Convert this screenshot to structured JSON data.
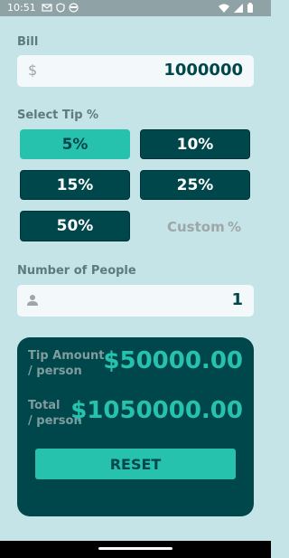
{
  "status": {
    "time": "10:51"
  },
  "bill": {
    "label": "Bill",
    "currency_symbol": "$",
    "value": "1000000"
  },
  "tip": {
    "label": "Select Tip %",
    "options": [
      "5%",
      "10%",
      "15%",
      "25%",
      "50%"
    ],
    "selected": "5%",
    "custom_placeholder": "Custom",
    "custom_suffix": "%"
  },
  "people": {
    "label": "Number of People",
    "value": "1"
  },
  "results": {
    "tip_label_line1": "Tip Amount",
    "tip_label_line2": "/ person",
    "tip_value": "$50000.00",
    "total_label_line1": "Total",
    "total_label_line2": "/ person",
    "total_value": "$1050000.00",
    "reset_label": "RESET"
  },
  "colors": {
    "background": "#c5e4e7",
    "dark_cyan": "#00474b",
    "accent": "#26c2ae",
    "input_bg": "#f3f8fb"
  }
}
